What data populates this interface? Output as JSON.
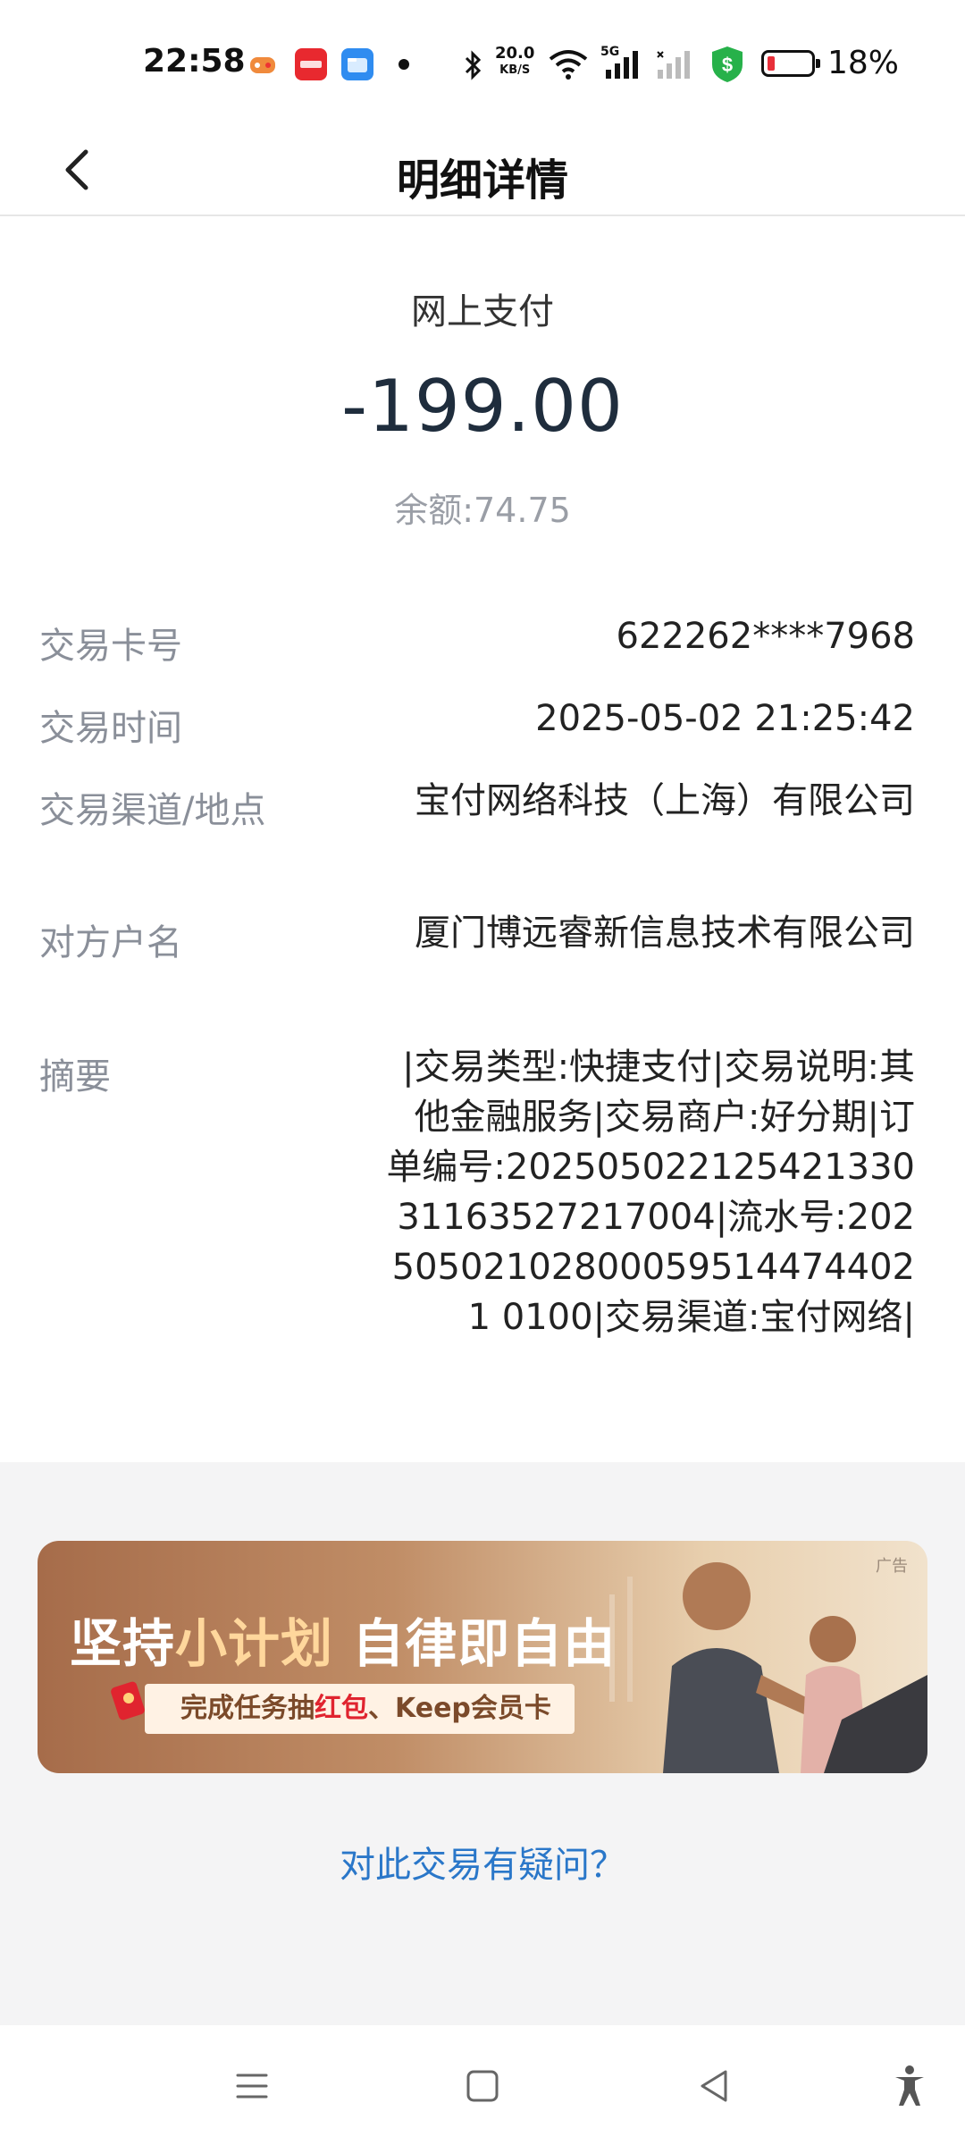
{
  "status_bar": {
    "time": "22:58",
    "net_speed_value": "20.0",
    "net_speed_unit": "KB/S",
    "network_type": "5G",
    "battery_percent": "18%",
    "battery_level": 0.18,
    "icons": [
      "game-app-icon",
      "haofenqi-app-icon",
      "folder-app-icon",
      "bluetooth-icon",
      "wifi-icon",
      "signal-icon",
      "signal-empty-icon",
      "security-shield-icon",
      "battery-icon"
    ]
  },
  "header": {
    "title": "明细详情",
    "back_icon": "chevron-left-icon"
  },
  "summary": {
    "type": "网上支付",
    "amount": "-199.00",
    "balance": "余额:74.75"
  },
  "details": {
    "card_no_label": "交易卡号",
    "card_no": "622262****7968",
    "time_label": "交易时间",
    "time": "2025-05-02 21:25:42",
    "channel_label": "交易渠道/地点",
    "channel": "宝付网络科技（上海）有限公司",
    "payee_label": "对方户名",
    "payee": "厦门博远睿新信息技术有限公司",
    "memo_label": "摘要",
    "memo": "|交易类型:快捷支付|交易说明:其他金融服务|交易商户:好分期|订单编号:20250502212542133031163527217004|流水号:202505021028000595144744021 0100|交易渠道:宝付网络|"
  },
  "banner": {
    "ad_tag": "广告",
    "title_pre": "坚持",
    "title_highlight": "小计划",
    "title_post": " 自律即自由",
    "sub_pre": "完成任务抽",
    "sub_highlight": "红包",
    "sub_post": "、Keep会员卡"
  },
  "question_link": "对此交易有疑问？",
  "nav_bar": {
    "icons": [
      "menu-icon",
      "home-square-icon",
      "back-triangle-icon",
      "accessibility-icon"
    ]
  },
  "colors": {
    "link": "#2a77c9",
    "amount": "#1f2d3d",
    "label": "#8a8f99",
    "grey_bg": "#f4f4f5"
  }
}
